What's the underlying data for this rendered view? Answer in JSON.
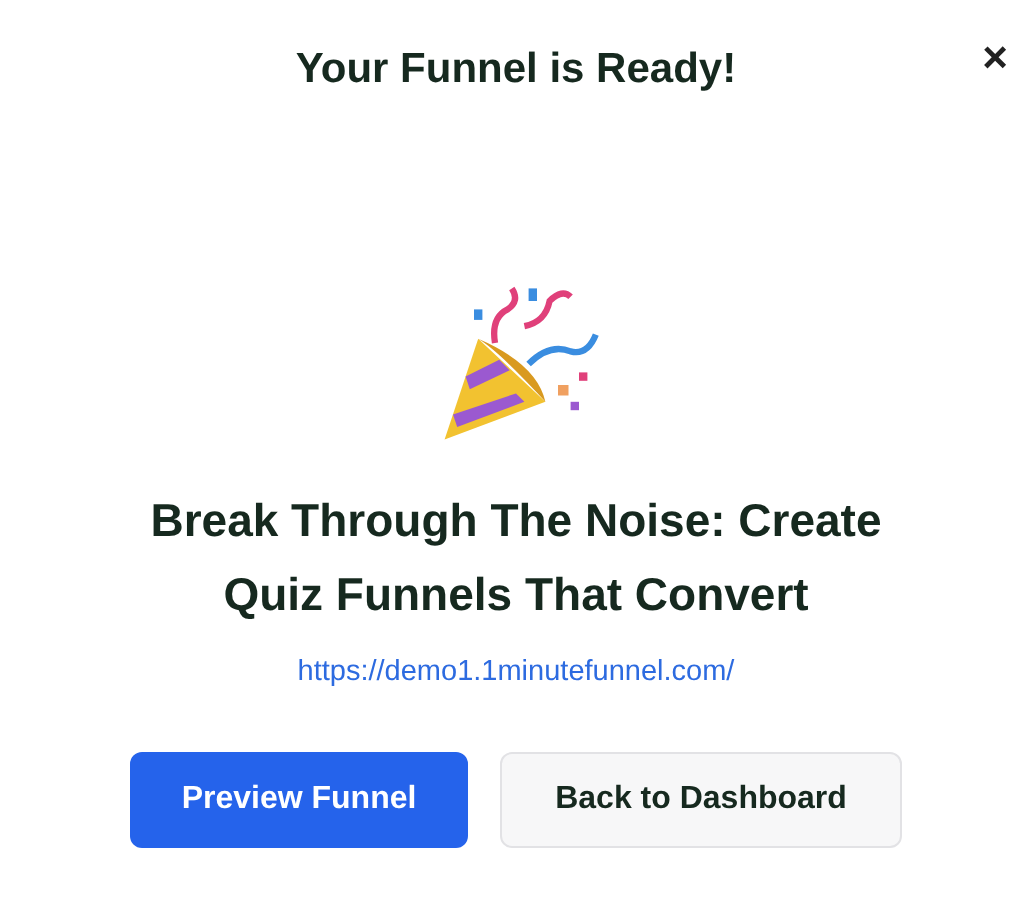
{
  "modal": {
    "title": "Your Funnel is Ready!",
    "close": "×"
  },
  "headline": "Break Through The Noise: Create Quiz Funnels That Convert",
  "link": "https://demo1.1minutefunnel.com/",
  "buttons": [
    {
      "label": "Preview Funnel",
      "kind": "primary"
    },
    {
      "label": "Back to Dashboard",
      "kind": "secondary"
    }
  ]
}
